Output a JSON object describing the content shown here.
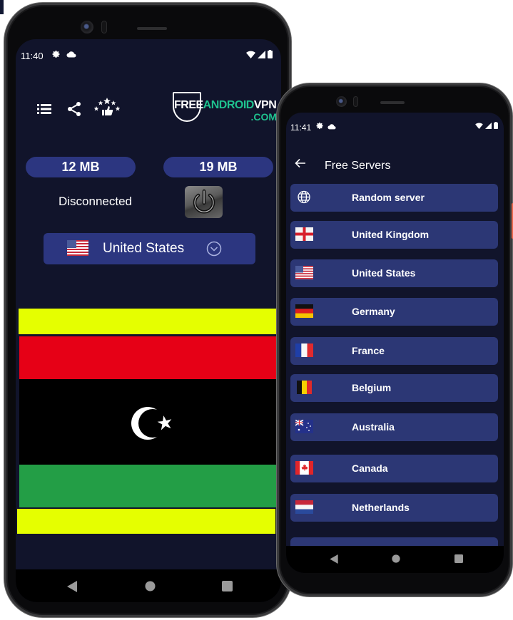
{
  "phone_main": {
    "status_bar": {
      "time": "11:40",
      "left_icons": [
        "settings-icon",
        "cloud-icon"
      ],
      "right_icons": [
        "wifi-icon",
        "signal-icon",
        "battery-icon"
      ]
    },
    "toolbar": {
      "icons": [
        "menu-list-icon",
        "share-icon",
        "rate-us-icon"
      ]
    },
    "logo": {
      "part_free": "FREE",
      "part_android": "ANDROID",
      "part_vpn": "VPN",
      "part_com": ".COM",
      "accent_color": "#1fc28f"
    },
    "traffic": {
      "download": "12 MB",
      "upload": "19 MB"
    },
    "connection": {
      "status": "Disconnected",
      "power_button_icon": "power-icon"
    },
    "country_selector": {
      "flag": "us-flag",
      "selected": "United States",
      "dropdown_icon": "chevron-down-circle-icon"
    },
    "flag_display": {
      "country": "Libya",
      "bands": [
        {
          "color": "#e5ff00"
        },
        {
          "color": "#e60016"
        },
        {
          "color": "#000000"
        },
        {
          "color": "#239e46"
        },
        {
          "color": "#e5ff00"
        }
      ]
    },
    "nav_bar": [
      "back-nav",
      "home-nav",
      "recents-nav"
    ]
  },
  "phone_servers": {
    "status_bar": {
      "time": "11:41",
      "left_icons": [
        "settings-icon",
        "cloud-icon"
      ],
      "right_icons": [
        "wifi-icon",
        "signal-icon",
        "battery-icon"
      ]
    },
    "header": {
      "back_icon": "arrow-left-icon",
      "title": "Free Servers"
    },
    "servers": [
      {
        "name": "Random server",
        "icon": "globe-icon"
      },
      {
        "name": "United Kingdom",
        "icon": "england-flag"
      },
      {
        "name": "United States",
        "icon": "us-flag"
      },
      {
        "name": "Germany",
        "icon": "germany-flag"
      },
      {
        "name": "France",
        "icon": "france-flag"
      },
      {
        "name": "Belgium",
        "icon": "belgium-flag"
      },
      {
        "name": "Australia",
        "icon": "australia-flag"
      },
      {
        "name": "Canada",
        "icon": "canada-flag"
      },
      {
        "name": "Netherlands",
        "icon": "netherlands-flag"
      }
    ],
    "nav_bar": [
      "back-nav",
      "home-nav",
      "recents-nav"
    ]
  },
  "colors": {
    "background": "#11142b",
    "card": "#2c3680",
    "list_item": "#2c3775",
    "text": "#ffffff"
  }
}
